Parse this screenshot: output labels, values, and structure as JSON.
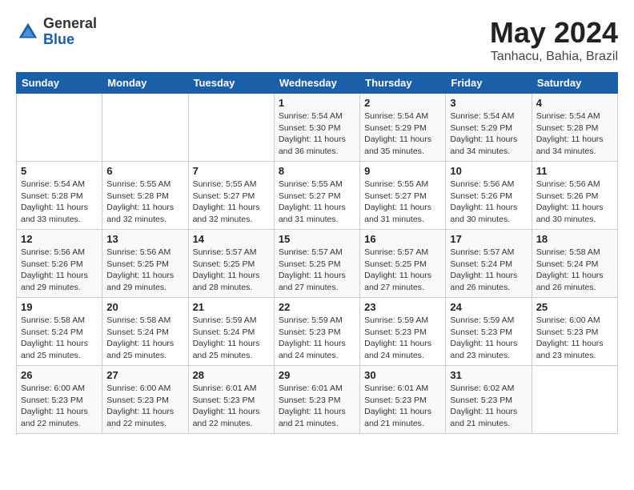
{
  "header": {
    "logo_general": "General",
    "logo_blue": "Blue",
    "month_year": "May 2024",
    "location": "Tanhacu, Bahia, Brazil"
  },
  "calendar": {
    "days_of_week": [
      "Sunday",
      "Monday",
      "Tuesday",
      "Wednesday",
      "Thursday",
      "Friday",
      "Saturday"
    ],
    "weeks": [
      [
        {
          "day": "",
          "info": ""
        },
        {
          "day": "",
          "info": ""
        },
        {
          "day": "",
          "info": ""
        },
        {
          "day": "1",
          "info": "Sunrise: 5:54 AM\nSunset: 5:30 PM\nDaylight: 11 hours\nand 36 minutes."
        },
        {
          "day": "2",
          "info": "Sunrise: 5:54 AM\nSunset: 5:29 PM\nDaylight: 11 hours\nand 35 minutes."
        },
        {
          "day": "3",
          "info": "Sunrise: 5:54 AM\nSunset: 5:29 PM\nDaylight: 11 hours\nand 34 minutes."
        },
        {
          "day": "4",
          "info": "Sunrise: 5:54 AM\nSunset: 5:28 PM\nDaylight: 11 hours\nand 34 minutes."
        }
      ],
      [
        {
          "day": "5",
          "info": "Sunrise: 5:54 AM\nSunset: 5:28 PM\nDaylight: 11 hours\nand 33 minutes."
        },
        {
          "day": "6",
          "info": "Sunrise: 5:55 AM\nSunset: 5:28 PM\nDaylight: 11 hours\nand 32 minutes."
        },
        {
          "day": "7",
          "info": "Sunrise: 5:55 AM\nSunset: 5:27 PM\nDaylight: 11 hours\nand 32 minutes."
        },
        {
          "day": "8",
          "info": "Sunrise: 5:55 AM\nSunset: 5:27 PM\nDaylight: 11 hours\nand 31 minutes."
        },
        {
          "day": "9",
          "info": "Sunrise: 5:55 AM\nSunset: 5:27 PM\nDaylight: 11 hours\nand 31 minutes."
        },
        {
          "day": "10",
          "info": "Sunrise: 5:56 AM\nSunset: 5:26 PM\nDaylight: 11 hours\nand 30 minutes."
        },
        {
          "day": "11",
          "info": "Sunrise: 5:56 AM\nSunset: 5:26 PM\nDaylight: 11 hours\nand 30 minutes."
        }
      ],
      [
        {
          "day": "12",
          "info": "Sunrise: 5:56 AM\nSunset: 5:26 PM\nDaylight: 11 hours\nand 29 minutes."
        },
        {
          "day": "13",
          "info": "Sunrise: 5:56 AM\nSunset: 5:25 PM\nDaylight: 11 hours\nand 29 minutes."
        },
        {
          "day": "14",
          "info": "Sunrise: 5:57 AM\nSunset: 5:25 PM\nDaylight: 11 hours\nand 28 minutes."
        },
        {
          "day": "15",
          "info": "Sunrise: 5:57 AM\nSunset: 5:25 PM\nDaylight: 11 hours\nand 27 minutes."
        },
        {
          "day": "16",
          "info": "Sunrise: 5:57 AM\nSunset: 5:25 PM\nDaylight: 11 hours\nand 27 minutes."
        },
        {
          "day": "17",
          "info": "Sunrise: 5:57 AM\nSunset: 5:24 PM\nDaylight: 11 hours\nand 26 minutes."
        },
        {
          "day": "18",
          "info": "Sunrise: 5:58 AM\nSunset: 5:24 PM\nDaylight: 11 hours\nand 26 minutes."
        }
      ],
      [
        {
          "day": "19",
          "info": "Sunrise: 5:58 AM\nSunset: 5:24 PM\nDaylight: 11 hours\nand 25 minutes."
        },
        {
          "day": "20",
          "info": "Sunrise: 5:58 AM\nSunset: 5:24 PM\nDaylight: 11 hours\nand 25 minutes."
        },
        {
          "day": "21",
          "info": "Sunrise: 5:59 AM\nSunset: 5:24 PM\nDaylight: 11 hours\nand 25 minutes."
        },
        {
          "day": "22",
          "info": "Sunrise: 5:59 AM\nSunset: 5:23 PM\nDaylight: 11 hours\nand 24 minutes."
        },
        {
          "day": "23",
          "info": "Sunrise: 5:59 AM\nSunset: 5:23 PM\nDaylight: 11 hours\nand 24 minutes."
        },
        {
          "day": "24",
          "info": "Sunrise: 5:59 AM\nSunset: 5:23 PM\nDaylight: 11 hours\nand 23 minutes."
        },
        {
          "day": "25",
          "info": "Sunrise: 6:00 AM\nSunset: 5:23 PM\nDaylight: 11 hours\nand 23 minutes."
        }
      ],
      [
        {
          "day": "26",
          "info": "Sunrise: 6:00 AM\nSunset: 5:23 PM\nDaylight: 11 hours\nand 22 minutes."
        },
        {
          "day": "27",
          "info": "Sunrise: 6:00 AM\nSunset: 5:23 PM\nDaylight: 11 hours\nand 22 minutes."
        },
        {
          "day": "28",
          "info": "Sunrise: 6:01 AM\nSunset: 5:23 PM\nDaylight: 11 hours\nand 22 minutes."
        },
        {
          "day": "29",
          "info": "Sunrise: 6:01 AM\nSunset: 5:23 PM\nDaylight: 11 hours\nand 21 minutes."
        },
        {
          "day": "30",
          "info": "Sunrise: 6:01 AM\nSunset: 5:23 PM\nDaylight: 11 hours\nand 21 minutes."
        },
        {
          "day": "31",
          "info": "Sunrise: 6:02 AM\nSunset: 5:23 PM\nDaylight: 11 hours\nand 21 minutes."
        },
        {
          "day": "",
          "info": ""
        }
      ]
    ]
  }
}
